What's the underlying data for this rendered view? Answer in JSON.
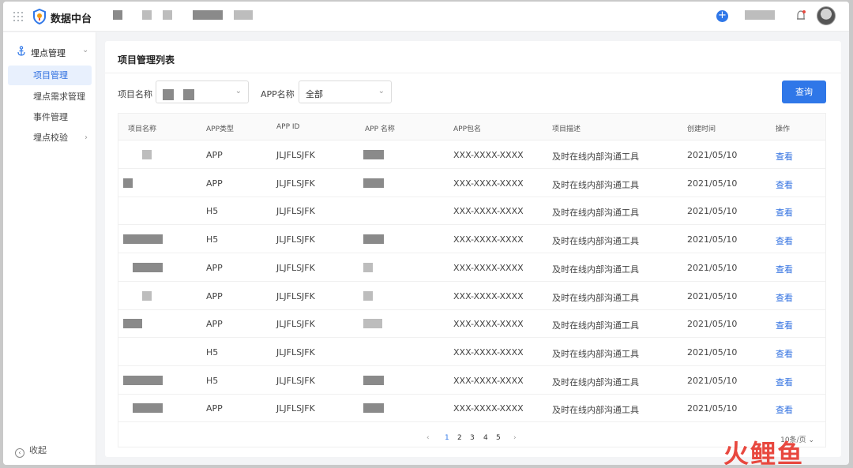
{
  "app": {
    "title": "数据中台"
  },
  "sidebar": {
    "group": {
      "label": "埋点管理"
    },
    "items": [
      {
        "label": "项目管理",
        "active": true
      },
      {
        "label": "埋点需求管理"
      },
      {
        "label": "事件管理"
      },
      {
        "label": "埋点校验",
        "has_children": true
      }
    ],
    "collapse_label": "收起"
  },
  "panel": {
    "title": "项目管理列表",
    "filters": {
      "project_name_label": "项目名称",
      "app_name_label": "APP名称",
      "app_name_value": "全部"
    },
    "query_label": "查询"
  },
  "table": {
    "headers": [
      "项目名称",
      "APP类型",
      "APP ID",
      "APP 名称",
      "APP包名",
      "项目描述",
      "创建时间",
      "操作"
    ],
    "rows": [
      {
        "type": "APP",
        "app_id": "JLJFLSJFK",
        "package": "XXX-XXXX-XXXX",
        "desc": "及时在线内部沟通工具",
        "created": "2021/05/10",
        "action": "查看"
      },
      {
        "type": "APP",
        "app_id": "JLJFLSJFK",
        "package": "XXX-XXXX-XXXX",
        "desc": "及时在线内部沟通工具",
        "created": "2021/05/10",
        "action": "查看"
      },
      {
        "type": "H5",
        "app_id": "JLJFLSJFK",
        "package": "XXX-XXXX-XXXX",
        "desc": "及时在线内部沟通工具",
        "created": "2021/05/10",
        "action": "查看"
      },
      {
        "type": "H5",
        "app_id": "JLJFLSJFK",
        "package": "XXX-XXXX-XXXX",
        "desc": "及时在线内部沟通工具",
        "created": "2021/05/10",
        "action": "查看"
      },
      {
        "type": "APP",
        "app_id": "JLJFLSJFK",
        "package": "XXX-XXXX-XXXX",
        "desc": "及时在线内部沟通工具",
        "created": "2021/05/10",
        "action": "查看"
      },
      {
        "type": "APP",
        "app_id": "JLJFLSJFK",
        "package": "XXX-XXXX-XXXX",
        "desc": "及时在线内部沟通工具",
        "created": "2021/05/10",
        "action": "查看"
      },
      {
        "type": "APP",
        "app_id": "JLJFLSJFK",
        "package": "XXX-XXXX-XXXX",
        "desc": "及时在线内部沟通工具",
        "created": "2021/05/10",
        "action": "查看"
      },
      {
        "type": "H5",
        "app_id": "JLJFLSJFK",
        "package": "XXX-XXXX-XXXX",
        "desc": "及时在线内部沟通工具",
        "created": "2021/05/10",
        "action": "查看"
      },
      {
        "type": "H5",
        "app_id": "JLJFLSJFK",
        "package": "XXX-XXXX-XXXX",
        "desc": "及时在线内部沟通工具",
        "created": "2021/05/10",
        "action": "查看"
      },
      {
        "type": "APP",
        "app_id": "JLJFLSJFK",
        "package": "XXX-XXXX-XXXX",
        "desc": "及时在线内部沟通工具",
        "created": "2021/05/10",
        "action": "查看"
      }
    ]
  },
  "pagination": {
    "pages": [
      "1",
      "2",
      "3",
      "4",
      "5"
    ],
    "current": "1",
    "prev": "‹",
    "next": "›",
    "page_size": "10条/页"
  },
  "watermark": {
    "text_a": "火",
    "text_b": "鲤鱼"
  },
  "colors": {
    "primary": "#2f77e8",
    "active_bg": "#e8f0fd"
  },
  "icons": [
    "apps-grid-icon",
    "shield-logo-icon",
    "plus-icon",
    "bell-icon",
    "anchor-icon",
    "chevron-down-icon",
    "chevron-right-icon",
    "collapse-icon"
  ]
}
